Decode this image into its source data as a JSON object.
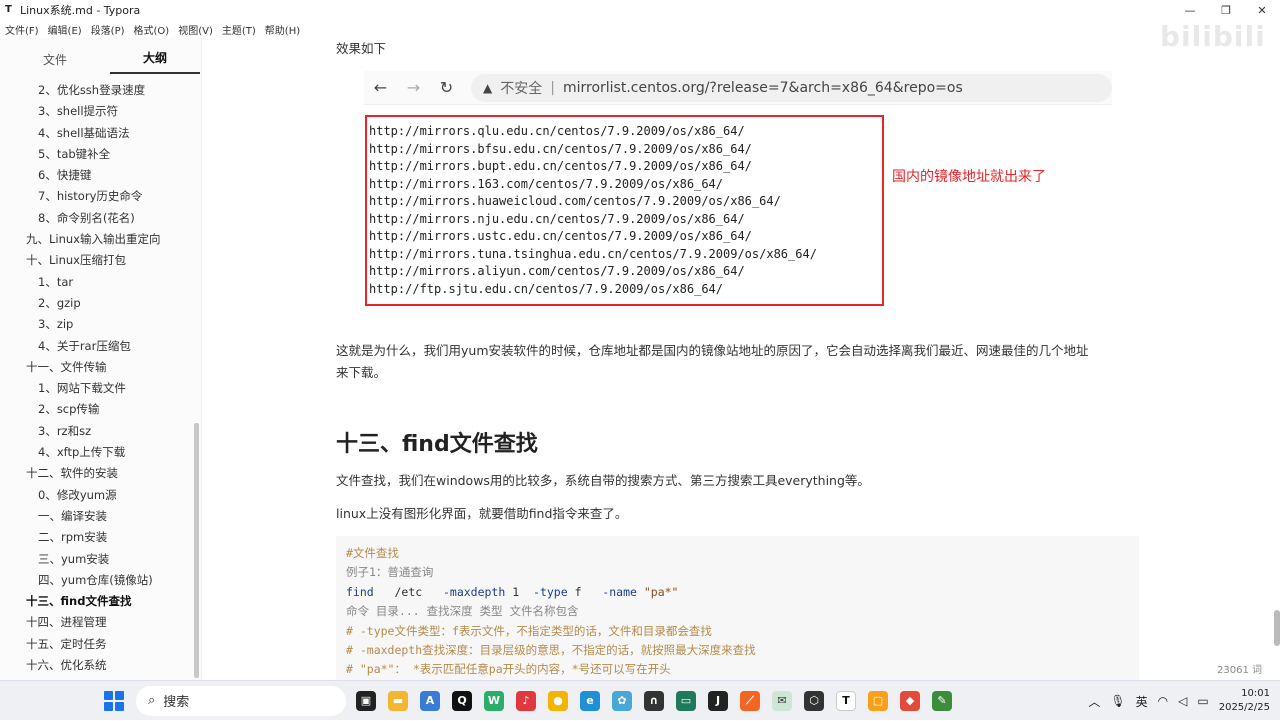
{
  "window": {
    "title": "Linux系统.md - Typora",
    "app_icon": "T"
  },
  "menu": [
    "文件(F)",
    "编辑(E)",
    "段落(P)",
    "格式(O)",
    "视图(V)",
    "主题(T)",
    "帮助(H)"
  ],
  "sidebar": {
    "tabs": [
      "文件",
      "大纲"
    ],
    "items": [
      {
        "label": "2、优化ssh登录速度",
        "level": 2
      },
      {
        "label": "3、shell提示符",
        "level": 2
      },
      {
        "label": "4、shell基础语法",
        "level": 2
      },
      {
        "label": "5、tab键补全",
        "level": 2
      },
      {
        "label": "6、快捷键",
        "level": 2
      },
      {
        "label": "7、history历史命令",
        "level": 2
      },
      {
        "label": "8、命令别名(花名)",
        "level": 2
      },
      {
        "label": "九、Linux输入输出重定向",
        "level": 1
      },
      {
        "label": "十、Linux压缩打包",
        "level": 1
      },
      {
        "label": "1、tar",
        "level": 2
      },
      {
        "label": "2、gzip",
        "level": 2
      },
      {
        "label": "3、zip",
        "level": 2
      },
      {
        "label": "4、关于rar压缩包",
        "level": 2
      },
      {
        "label": "十一、文件传输",
        "level": 1
      },
      {
        "label": "1、网站下载文件",
        "level": 2
      },
      {
        "label": "2、scp传输",
        "level": 2
      },
      {
        "label": "3、rz和sz",
        "level": 2
      },
      {
        "label": "4、xftp上传下载",
        "level": 2
      },
      {
        "label": "十二、软件的安装",
        "level": 1
      },
      {
        "label": "0、修改yum源",
        "level": 2
      },
      {
        "label": "一、编译安装",
        "level": 2
      },
      {
        "label": "二、rpm安装",
        "level": 2
      },
      {
        "label": "三、yum安装",
        "level": 2
      },
      {
        "label": "四、yum仓库(镜像站)",
        "level": 2
      },
      {
        "label": "十三、find文件查找",
        "level": 1,
        "active": true
      },
      {
        "label": "十四、进程管理",
        "level": 1
      },
      {
        "label": "十五、定时任务",
        "level": 1
      },
      {
        "label": "十六、优化系统",
        "level": 1
      }
    ],
    "bottom_left": "‹",
    "bottom_source": "</>"
  },
  "main": {
    "effect_label": "效果如下",
    "browser": {
      "insecure": "不安全",
      "url": "mirrorlist.centos.org/?release=7&arch=x86_64&repo=os"
    },
    "mirrors": [
      "http://mirrors.qlu.edu.cn/centos/7.9.2009/os/x86_64/",
      "http://mirrors.bfsu.edu.cn/centos/7.9.2009/os/x86_64/",
      "http://mirrors.bupt.edu.cn/centos/7.9.2009/os/x86_64/",
      "http://mirrors.163.com/centos/7.9.2009/os/x86_64/",
      "http://mirrors.huaweicloud.com/centos/7.9.2009/os/x86_64/",
      "http://mirrors.nju.edu.cn/centos/7.9.2009/os/x86_64/",
      "http://mirrors.ustc.edu.cn/centos/7.9.2009/os/x86_64/",
      "http://mirrors.tuna.tsinghua.edu.cn/centos/7.9.2009/os/x86_64/",
      "http://mirrors.aliyun.com/centos/7.9.2009/os/x86_64/",
      "http://ftp.sjtu.edu.cn/centos/7.9.2009/os/x86_64/"
    ],
    "mirror_note": "国内的镜像地址就出来了",
    "explain_line1": "这就是为什么，我们用yum安装软件的时候，仓库地址都是国内的镜像站地址的原因了，它会自动选择离我们最近、网速最佳的几个地址",
    "explain_line2": "来下载。",
    "heading": "十三、find文件查找",
    "p1": "文件查找，我们在windows用的比较多，系统自带的搜索方式、第三方搜索工具everything等。",
    "p2": "linux上没有图形化界面，就要借助find指令来查了。",
    "code": {
      "l1": "#文件查找",
      "l2": "例子1：普通查询",
      "l3_cmd": "find",
      "l3_path": "/etc",
      "l3_opt1": "-maxdepth",
      "l3_n": "1",
      "l3_opt2": "-type",
      "l3_f": "f",
      "l3_opt3": "-name",
      "l3_str": "\"pa*\"",
      "l4": "命令    目录...    查找深度      类型    文件名称包含",
      "l5": "# -type文件类型：f表示文件，不指定类型的话，文件和目录都会查找",
      "l6": "# -maxdepth查找深度：目录层级的意思，不指定的话，就按照最大深度来查找",
      "l7": "# \"pa*\"：  *表示匹配任意pa开头的内容，*号还可以写在开头"
    },
    "word_count": "23061 词"
  },
  "watermark": "bilibili",
  "taskbar": {
    "search_placeholder": "搜索",
    "ime": "英",
    "time": "10:01",
    "date": "2025/2/25"
  }
}
